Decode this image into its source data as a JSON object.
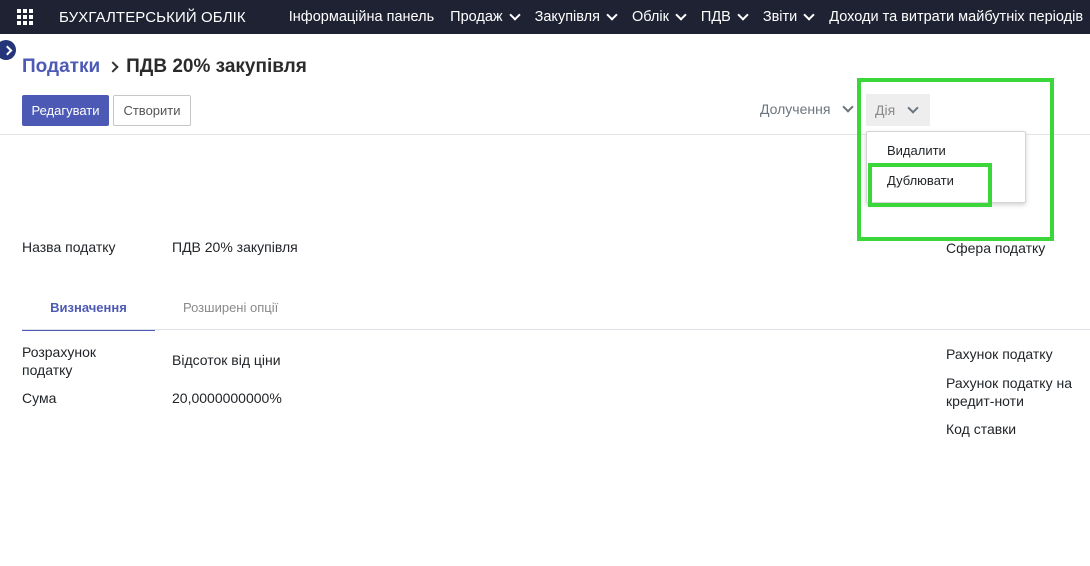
{
  "navbar": {
    "brand": "БУХГАЛТЕРСЬКИЙ ОБЛІК",
    "menu": [
      {
        "label": "Інформаційна панель",
        "has_dropdown": false
      },
      {
        "label": "Продаж",
        "has_dropdown": true
      },
      {
        "label": "Закупівля",
        "has_dropdown": true
      },
      {
        "label": "Облік",
        "has_dropdown": true
      },
      {
        "label": "ПДВ",
        "has_dropdown": true
      },
      {
        "label": "Звіти",
        "has_dropdown": true
      },
      {
        "label": "Доходи та витрати майбутніх періодів",
        "has_dropdown": false
      }
    ]
  },
  "breadcrumb": {
    "parent": "Податки",
    "current": "ПДВ 20% закупівля"
  },
  "buttons": {
    "edit": "Редагувати",
    "create": "Створити"
  },
  "toolbar": {
    "print": "Долучення",
    "action": "Дія"
  },
  "dropdown": {
    "items": [
      "Видалити",
      "Дублювати"
    ]
  },
  "form": {
    "tax_name_label": "Назва податку",
    "tax_name_value": "ПДВ 20% закупівля",
    "tax_scope_label": "Сфера податку",
    "tabs": [
      "Визначення",
      "Розширені опції"
    ],
    "tax_computation_label": "Розрахунок податку",
    "tax_computation_value": "Відсоток від ціни",
    "amount_label": "Сума",
    "amount_value": "20,0000000000%",
    "tax_account_label": "Рахунок податку",
    "credit_note_account_label": "Рахунок податку на кредит-ноти",
    "rate_code_label": "Код ставки"
  },
  "colors": {
    "navbar_bg": "#1f2233",
    "primary": "#4c5ab5",
    "highlight": "#3ad63a"
  },
  "icons": [
    "apps-grid-icon",
    "chevron-down-icon",
    "sidebar-toggle-icon",
    "chevron-right-icon"
  ]
}
